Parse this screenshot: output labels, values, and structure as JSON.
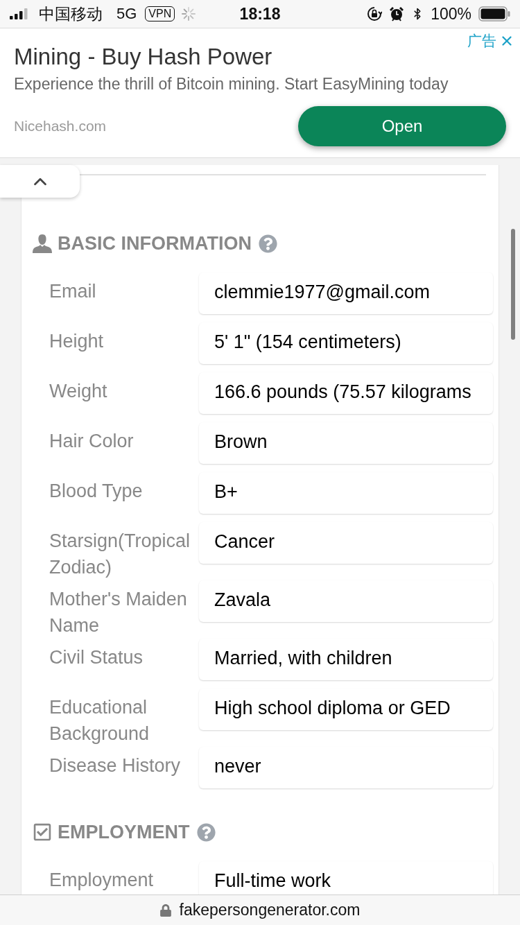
{
  "status_bar": {
    "carrier": "中国移动",
    "network": "5G",
    "vpn": "VPN",
    "time": "18:18",
    "battery": "100%"
  },
  "ad": {
    "label": "广告",
    "title": "Mining - Buy Hash Power",
    "description": "Experience the thrill of Bitcoin mining. Start EasyMining today",
    "domain": "Nicehash.com",
    "button": "Open"
  },
  "sections": [
    {
      "kind": "person",
      "title": "BASIC INFORMATION",
      "fields": [
        {
          "label": "Email",
          "value": "clemmie1977@gmail.com"
        },
        {
          "label": "Height",
          "value": "5' 1\" (154 centimeters)"
        },
        {
          "label": "Weight",
          "value": "166.6 pounds (75.57 kilograms"
        },
        {
          "label": "Hair Color",
          "value": "Brown"
        },
        {
          "label": "Blood Type",
          "value": "B+"
        },
        {
          "label": "Starsign(Tropical Zodiac)",
          "value": "Cancer"
        },
        {
          "label": "Mother's Maiden Name",
          "value": "Zavala"
        },
        {
          "label": "Civil Status",
          "value": "Married, with children"
        },
        {
          "label": "Educational Background",
          "value": "High school diploma or GED"
        },
        {
          "label": "Disease History",
          "value": "never"
        }
      ]
    },
    {
      "kind": "employment",
      "title": "EMPLOYMENT",
      "fields": [
        {
          "label": "Employment",
          "value": "Full-time work"
        }
      ]
    }
  ],
  "address_bar": {
    "url": "fakepersongenerator.com"
  }
}
